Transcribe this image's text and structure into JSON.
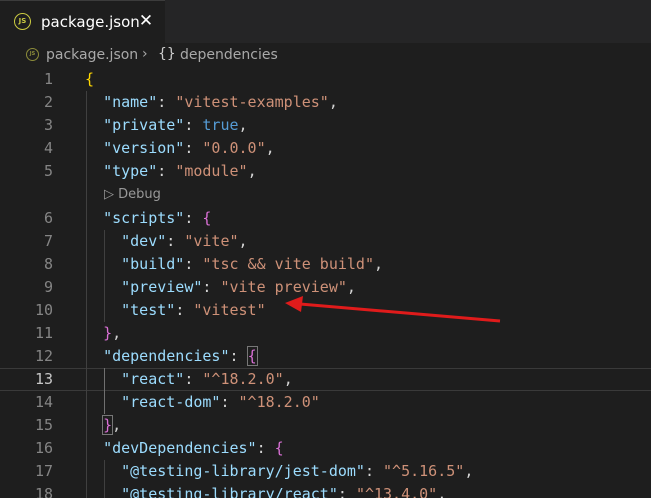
{
  "tab": {
    "icon": "json-file-icon",
    "icon_text": "JS",
    "title": "package.json",
    "close_glyph": "✕"
  },
  "breadcrumb": {
    "file": "package.json",
    "separator": "›",
    "symbol_glyph": "{}",
    "item": "dependencies"
  },
  "codelens": {
    "label": "▷ Debug"
  },
  "colors": {
    "editor_bg": "#1e1e1e",
    "key": "#9cdcfe",
    "string": "#ce9178",
    "boolean": "#569cd6",
    "bracket_level1": "#ffd700",
    "bracket_level2": "#da70d6",
    "annotation_arrow": "#e01b1b"
  },
  "annotation": {
    "type": "red-arrow",
    "points_to_line": 10
  },
  "editor": {
    "current_line": 13,
    "lines": [
      {
        "n": "1",
        "tokens": [
          {
            "t": "{",
            "c": "br1"
          }
        ]
      },
      {
        "n": "2",
        "tokens": [
          {
            "t": "  ",
            "c": "p"
          },
          {
            "t": "\"name\"",
            "c": "k"
          },
          {
            "t": ": ",
            "c": "p"
          },
          {
            "t": "\"vitest-examples\"",
            "c": "s"
          },
          {
            "t": ",",
            "c": "p"
          }
        ]
      },
      {
        "n": "3",
        "tokens": [
          {
            "t": "  ",
            "c": "p"
          },
          {
            "t": "\"private\"",
            "c": "k"
          },
          {
            "t": ": ",
            "c": "p"
          },
          {
            "t": "true",
            "c": "b"
          },
          {
            "t": ",",
            "c": "p"
          }
        ]
      },
      {
        "n": "4",
        "tokens": [
          {
            "t": "  ",
            "c": "p"
          },
          {
            "t": "\"version\"",
            "c": "k"
          },
          {
            "t": ": ",
            "c": "p"
          },
          {
            "t": "\"0.0.0\"",
            "c": "s"
          },
          {
            "t": ",",
            "c": "p"
          }
        ]
      },
      {
        "n": "5",
        "tokens": [
          {
            "t": "  ",
            "c": "p"
          },
          {
            "t": "\"type\"",
            "c": "k"
          },
          {
            "t": ": ",
            "c": "p"
          },
          {
            "t": "\"module\"",
            "c": "s"
          },
          {
            "t": ",",
            "c": "p"
          }
        ]
      },
      {
        "n": "6",
        "tokens": [
          {
            "t": "  ",
            "c": "p"
          },
          {
            "t": "\"scripts\"",
            "c": "k"
          },
          {
            "t": ": ",
            "c": "p"
          },
          {
            "t": "{",
            "c": "br2"
          }
        ]
      },
      {
        "n": "7",
        "tokens": [
          {
            "t": "    ",
            "c": "p"
          },
          {
            "t": "\"dev\"",
            "c": "k"
          },
          {
            "t": ": ",
            "c": "p"
          },
          {
            "t": "\"vite\"",
            "c": "s"
          },
          {
            "t": ",",
            "c": "p"
          }
        ]
      },
      {
        "n": "8",
        "tokens": [
          {
            "t": "    ",
            "c": "p"
          },
          {
            "t": "\"build\"",
            "c": "k"
          },
          {
            "t": ": ",
            "c": "p"
          },
          {
            "t": "\"tsc && vite build\"",
            "c": "s"
          },
          {
            "t": ",",
            "c": "p"
          }
        ]
      },
      {
        "n": "9",
        "tokens": [
          {
            "t": "    ",
            "c": "p"
          },
          {
            "t": "\"preview\"",
            "c": "k"
          },
          {
            "t": ": ",
            "c": "p"
          },
          {
            "t": "\"vite preview\"",
            "c": "s"
          },
          {
            "t": ",",
            "c": "p"
          }
        ]
      },
      {
        "n": "10",
        "tokens": [
          {
            "t": "    ",
            "c": "p"
          },
          {
            "t": "\"test\"",
            "c": "k"
          },
          {
            "t": ": ",
            "c": "p"
          },
          {
            "t": "\"vitest\"",
            "c": "s"
          }
        ]
      },
      {
        "n": "11",
        "tokens": [
          {
            "t": "  ",
            "c": "p"
          },
          {
            "t": "}",
            "c": "br2"
          },
          {
            "t": ",",
            "c": "p"
          }
        ]
      },
      {
        "n": "12",
        "tokens": [
          {
            "t": "  ",
            "c": "p"
          },
          {
            "t": "\"dependencies\"",
            "c": "k"
          },
          {
            "t": ": ",
            "c": "p"
          },
          {
            "t": "{",
            "c": "br2-box"
          }
        ]
      },
      {
        "n": "13",
        "tokens": [
          {
            "t": "    ",
            "c": "p"
          },
          {
            "t": "\"react\"",
            "c": "k"
          },
          {
            "t": ": ",
            "c": "p"
          },
          {
            "t": "\"^18.2.0\"",
            "c": "s"
          },
          {
            "t": ",",
            "c": "p"
          }
        ]
      },
      {
        "n": "14",
        "tokens": [
          {
            "t": "    ",
            "c": "p"
          },
          {
            "t": "\"react-dom\"",
            "c": "k"
          },
          {
            "t": ": ",
            "c": "p"
          },
          {
            "t": "\"^18.2.0\"",
            "c": "s"
          }
        ]
      },
      {
        "n": "15",
        "tokens": [
          {
            "t": "  ",
            "c": "p"
          },
          {
            "t": "}",
            "c": "br2-box"
          },
          {
            "t": ",",
            "c": "p"
          }
        ]
      },
      {
        "n": "16",
        "tokens": [
          {
            "t": "  ",
            "c": "p"
          },
          {
            "t": "\"devDependencies\"",
            "c": "k"
          },
          {
            "t": ": ",
            "c": "p"
          },
          {
            "t": "{",
            "c": "br2"
          }
        ]
      },
      {
        "n": "17",
        "tokens": [
          {
            "t": "    ",
            "c": "p"
          },
          {
            "t": "\"@testing-library/jest-dom\"",
            "c": "k"
          },
          {
            "t": ": ",
            "c": "p"
          },
          {
            "t": "\"^5.16.5\"",
            "c": "s"
          },
          {
            "t": ",",
            "c": "p"
          }
        ]
      },
      {
        "n": "18",
        "tokens": [
          {
            "t": "    ",
            "c": "p"
          },
          {
            "t": "\"@testing-library/react\"",
            "c": "k"
          },
          {
            "t": ": ",
            "c": "p"
          },
          {
            "t": "\"^13.4.0\"",
            "c": "s"
          },
          {
            "t": ",",
            "c": "p"
          }
        ]
      }
    ]
  }
}
